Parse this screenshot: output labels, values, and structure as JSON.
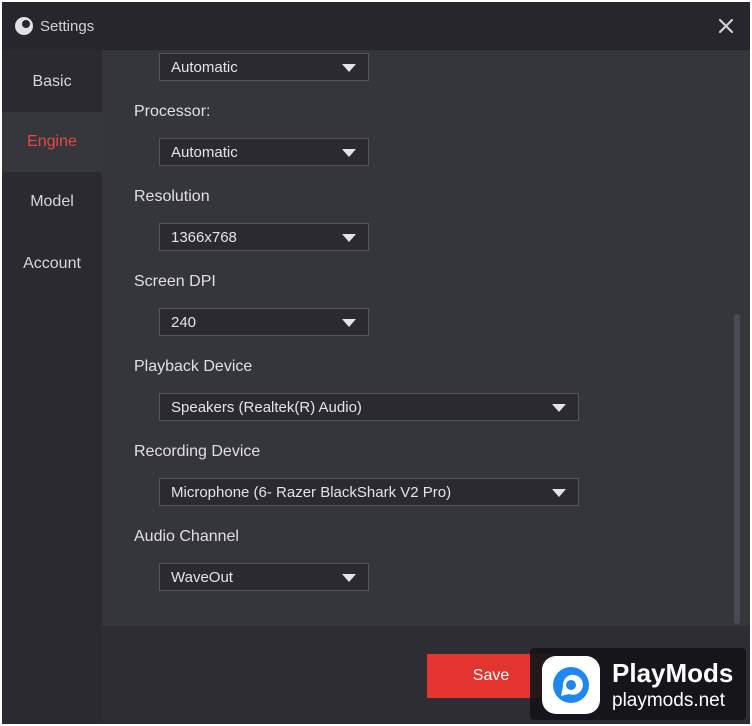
{
  "window": {
    "title": "Settings"
  },
  "sidebar": {
    "items": [
      {
        "label": "Basic",
        "active": false
      },
      {
        "label": "Engine",
        "active": true
      },
      {
        "label": "Model",
        "active": false
      },
      {
        "label": "Account",
        "active": false
      }
    ]
  },
  "settings": {
    "top_select": {
      "value": "Automatic"
    },
    "processor": {
      "label": "Processor:",
      "value": "Automatic"
    },
    "resolution": {
      "label": "Resolution",
      "value": "1366x768"
    },
    "screen_dpi": {
      "label": "Screen DPI",
      "value": "240"
    },
    "playback_device": {
      "label": "Playback Device",
      "value": "Speakers (Realtek(R) Audio)"
    },
    "recording_device": {
      "label": "Recording Device",
      "value": "Microphone (6- Razer BlackShark V2 Pro)"
    },
    "audio_channel": {
      "label": "Audio Channel",
      "value": "WaveOut"
    }
  },
  "footer": {
    "save_label": "Save"
  },
  "watermark": {
    "name": "PlayMods",
    "url": "playmods.net"
  },
  "colors": {
    "accent": "#e3342f",
    "background": "#2d2d33",
    "content": "#35353c"
  }
}
